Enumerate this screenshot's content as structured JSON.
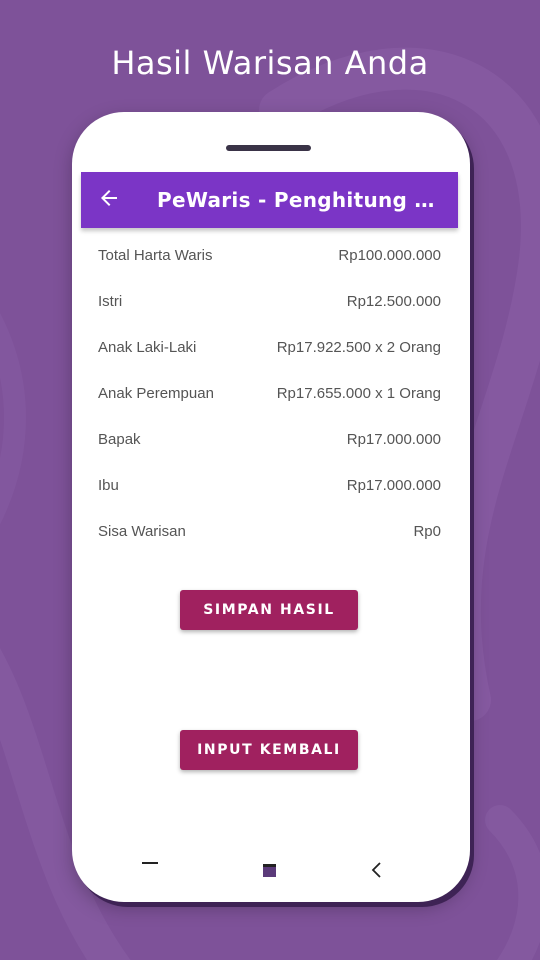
{
  "promo": {
    "title": "Hasil Warisan Anda"
  },
  "app": {
    "title": "PeWaris - Penghitung Warisan",
    "back_icon": "arrow-left-icon"
  },
  "results": [
    {
      "label": "Total Harta Waris",
      "value": "Rp100.000.000"
    },
    {
      "label": "Istri",
      "value": "Rp12.500.000"
    },
    {
      "label": "Anak Laki-Laki",
      "value": "Rp17.922.500 x 2 Orang"
    },
    {
      "label": "Anak Perempuan",
      "value": "Rp17.655.000 x 1 Orang"
    },
    {
      "label": "Bapak",
      "value": "Rp17.000.000"
    },
    {
      "label": "Ibu",
      "value": "Rp17.000.000"
    },
    {
      "label": "Sisa Warisan",
      "value": "Rp0"
    }
  ],
  "buttons": {
    "save_label": "SIMPAN HASIL",
    "input_again_label": "INPUT KEMBALI"
  },
  "colors": {
    "background": "#7e5299",
    "appbar": "#7b35c6",
    "button": "#a0215f"
  }
}
